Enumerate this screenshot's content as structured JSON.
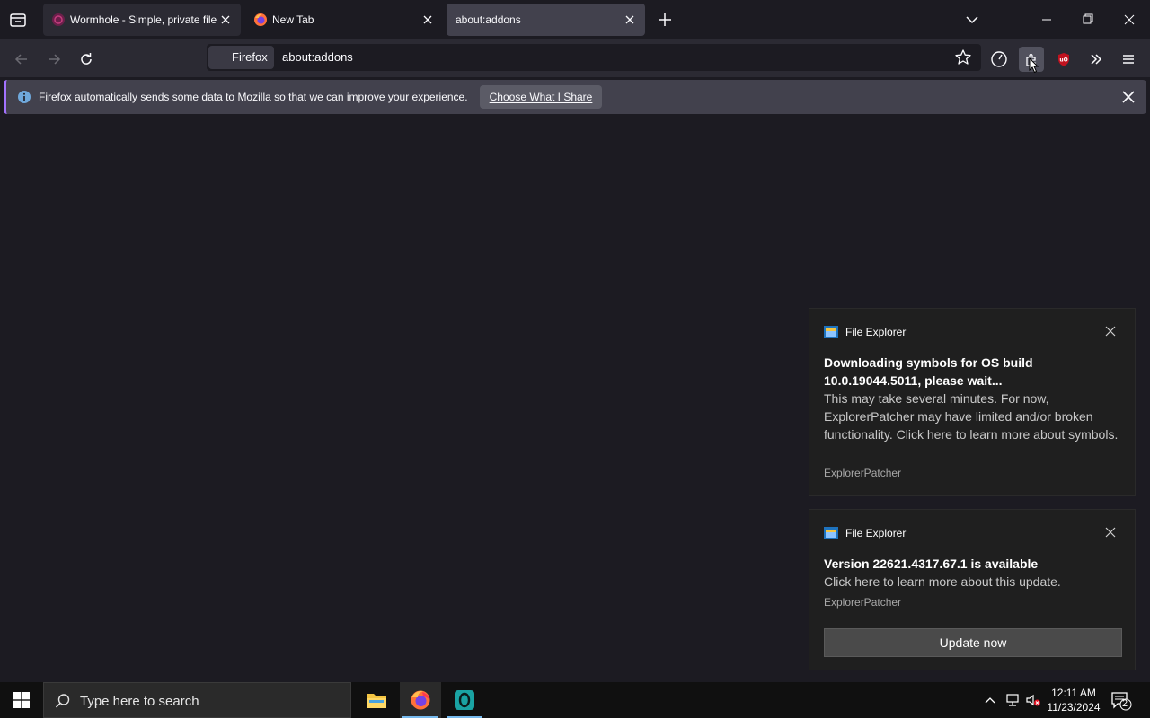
{
  "browser": {
    "tabs": [
      {
        "title": "Wormhole - Simple, private file",
        "active": false
      },
      {
        "title": "New Tab",
        "active": false
      },
      {
        "title": "about:addons",
        "active": true
      }
    ],
    "identity_label": "Firefox",
    "url": "about:addons"
  },
  "notification": {
    "message": "Firefox automatically sends some data to Mozilla so that we can improve your experience.",
    "button_label": "Choose What I Share"
  },
  "toasts": [
    {
      "app": "File Explorer",
      "heading_line1": "Downloading symbols for OS build",
      "heading_line2": "10.0.19044.5011, please wait...",
      "body": "This may take several minutes. For now, ExplorerPatcher may have limited and/or broken functionality. Click here to learn more about symbols.",
      "source": "ExplorerPatcher"
    },
    {
      "app": "File Explorer",
      "heading": "Version 22621.4317.67.1 is available",
      "body": "Click here to learn more about this update.",
      "source": "ExplorerPatcher",
      "button_label": "Update now"
    }
  ],
  "taskbar": {
    "search_placeholder": "Type here to search",
    "time": "12:11 AM",
    "date": "11/23/2024",
    "notification_count": "2"
  },
  "colors": {
    "accent": "#a372ff",
    "taskbar_active": "#76b9ed",
    "ublock_red": "#c1121f"
  }
}
